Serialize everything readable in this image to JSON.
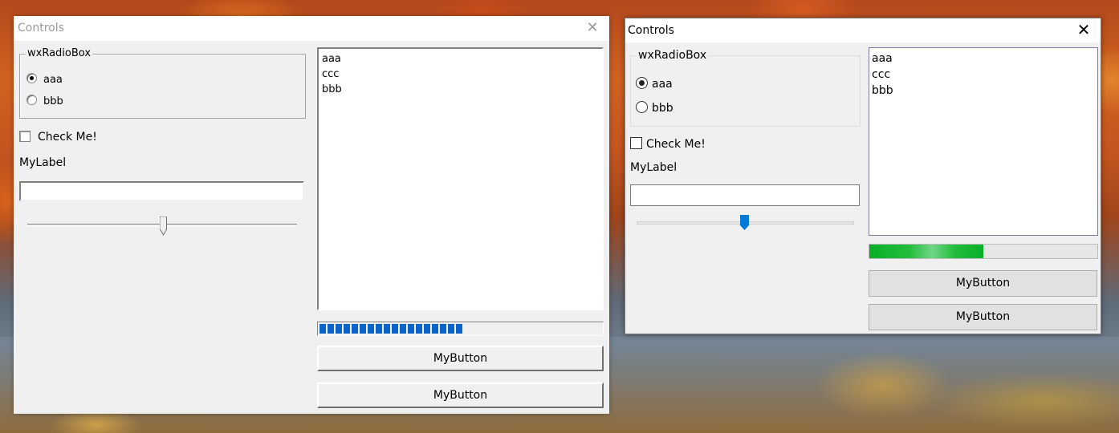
{
  "left_window": {
    "title": "Controls",
    "close_symbol": "✕",
    "radiobox": {
      "label": "wxRadioBox",
      "options": [
        {
          "label": "aaa",
          "selected": true
        },
        {
          "label": "bbb",
          "selected": false
        }
      ]
    },
    "checkbox": {
      "label": "Check Me!",
      "checked": false
    },
    "static_label": "MyLabel",
    "text_input": {
      "value": ""
    },
    "slider": {
      "value_fraction": 0.5
    },
    "listbox": {
      "items": [
        "aaa",
        "ccc",
        "bbb"
      ]
    },
    "progress": {
      "value_fraction": 0.5,
      "color": "#0a63c9"
    },
    "buttons": [
      "MyButton",
      "MyButton"
    ]
  },
  "right_window": {
    "title": "Controls",
    "close_symbol": "✕",
    "radiobox": {
      "label": "wxRadioBox",
      "options": [
        {
          "label": "aaa",
          "selected": true
        },
        {
          "label": "bbb",
          "selected": false
        }
      ]
    },
    "checkbox": {
      "label": "Check Me!",
      "checked": false
    },
    "static_label": "MyLabel",
    "text_input": {
      "value": ""
    },
    "slider": {
      "value_fraction": 0.5,
      "thumb_color": "#0078d7"
    },
    "listbox": {
      "items": [
        "aaa",
        "ccc",
        "bbb"
      ]
    },
    "progress": {
      "value_fraction": 0.5,
      "color": "#06b025"
    },
    "buttons": [
      "MyButton",
      "MyButton"
    ]
  }
}
